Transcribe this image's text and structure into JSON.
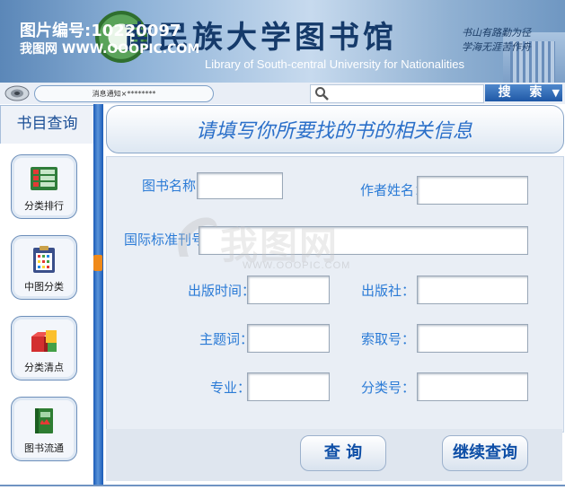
{
  "header": {
    "title": "南民族大学图书馆",
    "subtitle": "Library of South-central University for Nationalities",
    "watermark_id": "图片编号:10220097",
    "watermark_site": "我图网  WWW.OOOPIC.COM",
    "motto_line1": "书山有路勤为径",
    "motto_line2": "学海无涯苦作舟"
  },
  "notice": {
    "label": "消息通知"
  },
  "search": {
    "placeholder": "",
    "button_label": "搜 索",
    "dropdown_arrow": "▼"
  },
  "sidebar": {
    "title": "书目查询",
    "items": [
      {
        "label": "分类排行",
        "icon": "ranking-list-icon"
      },
      {
        "label": "中图分类",
        "icon": "clipboard-grid-icon"
      },
      {
        "label": "分类清点",
        "icon": "boxes-icon"
      },
      {
        "label": "图书流通",
        "icon": "book-icon"
      }
    ]
  },
  "main": {
    "heading": "请填写你所要找的书的相关信息",
    "fields": {
      "book_name": "图书名称：",
      "author": "作者姓名：",
      "isbn": "国际标准刊号：",
      "pub_date": "出版时间：",
      "publisher": "出版社：",
      "keyword": "主题词：",
      "call_number": "索取号：",
      "major": "专业：",
      "class_number": "分类号："
    },
    "buttons": {
      "search": "查  询",
      "continue": "继续查询"
    }
  },
  "watermark": {
    "logo_text": "我图网",
    "url": "WWW.OOOPIC.COM"
  },
  "colors": {
    "accent": "#2b7bd6",
    "stripe": "#1a5bb8",
    "header": "#8fb3d8"
  }
}
